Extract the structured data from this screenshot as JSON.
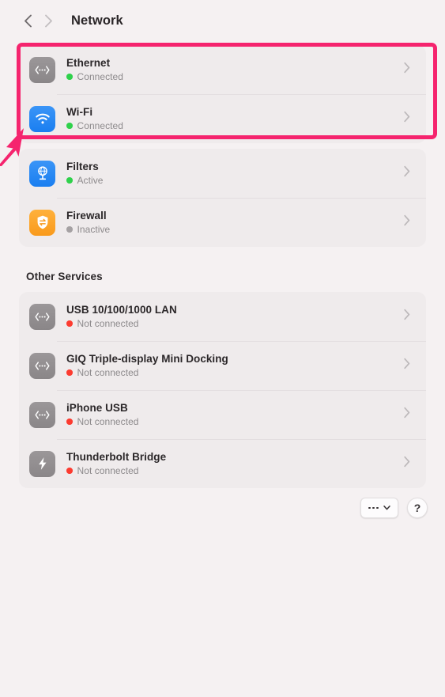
{
  "window": {
    "title": "Network",
    "background_color": "#f5f1f2"
  },
  "header": {
    "back_icon": "chevron-left-icon",
    "forward_icon": "chevron-right-icon",
    "title": "Network"
  },
  "highlight": {
    "color": "#f5246e",
    "annotation_icon": "arrow-pointer-icon",
    "target": "primary-services-card"
  },
  "status_colors": {
    "connected": "#2fd14b",
    "not_connected": "#fc3b30",
    "inactive": "#a5a1a3",
    "active": "#2fd14b"
  },
  "primary_services": [
    {
      "name": "Ethernet",
      "status": "Connected",
      "status_state": "connected",
      "icon": "ethernet-icon",
      "icon_style": "gray"
    },
    {
      "name": "Wi-Fi",
      "status": "Connected",
      "status_state": "connected",
      "icon": "wifi-icon",
      "icon_style": "blue"
    }
  ],
  "secondary_services": [
    {
      "name": "Filters",
      "status": "Active",
      "status_state": "active",
      "icon": "filters-globe-icon",
      "icon_style": "blue"
    },
    {
      "name": "Firewall",
      "status": "Inactive",
      "status_state": "inactive",
      "icon": "firewall-shield-icon",
      "icon_style": "orange"
    }
  ],
  "other_services_heading": "Other Services",
  "other_services": [
    {
      "name": "USB 10/100/1000 LAN",
      "status": "Not connected",
      "status_state": "not_connected",
      "icon": "ethernet-icon",
      "icon_style": "gray"
    },
    {
      "name": "GIQ Triple-display Mini Docking",
      "status": "Not connected",
      "status_state": "not_connected",
      "icon": "ethernet-icon",
      "icon_style": "gray"
    },
    {
      "name": "iPhone USB",
      "status": "Not connected",
      "status_state": "not_connected",
      "icon": "ethernet-icon",
      "icon_style": "gray"
    },
    {
      "name": "Thunderbolt Bridge",
      "status": "Not connected",
      "status_state": "not_connected",
      "icon": "thunderbolt-icon",
      "icon_style": "gray"
    }
  ],
  "footer": {
    "more_label": "•••",
    "more_icon": "ellipsis-icon",
    "more_chevron_icon": "chevron-down-icon",
    "help_label": "?",
    "help_icon": "question-mark-icon"
  }
}
